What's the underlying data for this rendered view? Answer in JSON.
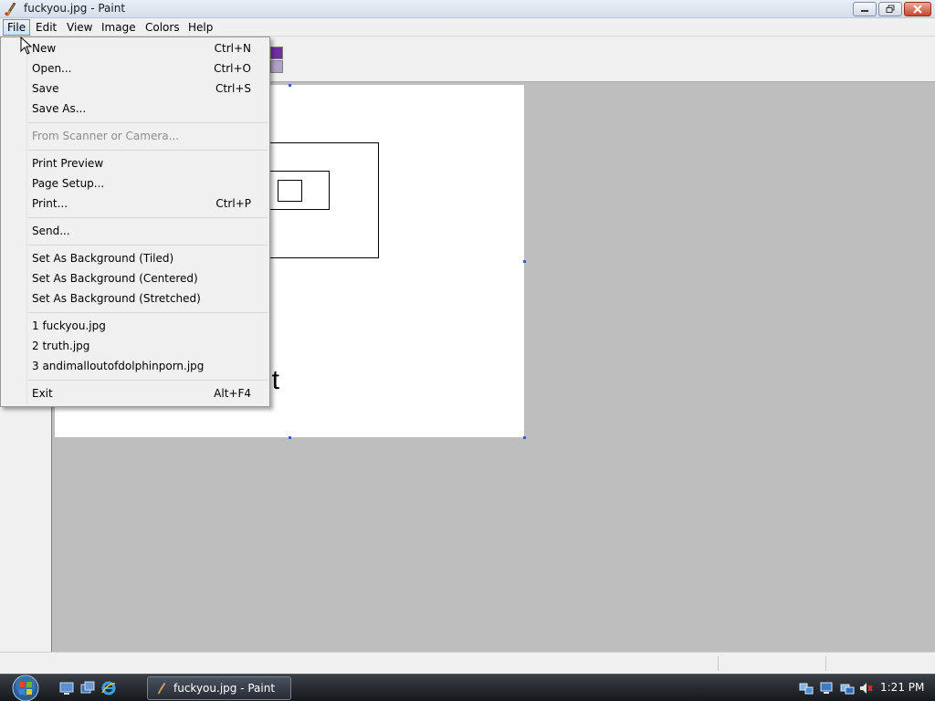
{
  "window": {
    "title": "fuckyou.jpg - Paint",
    "app_icon": "paint-brush-icon"
  },
  "menubar": {
    "items": [
      "File",
      "Edit",
      "View",
      "Image",
      "Colors",
      "Help"
    ],
    "active": "File"
  },
  "file_menu": {
    "new": {
      "label": "New",
      "shortcut": "Ctrl+N"
    },
    "open": {
      "label": "Open...",
      "shortcut": "Ctrl+O"
    },
    "save": {
      "label": "Save",
      "shortcut": "Ctrl+S"
    },
    "save_as": {
      "label": "Save As..."
    },
    "from_scanner": {
      "label": "From Scanner or Camera...",
      "enabled": false
    },
    "print_preview": {
      "label": "Print Preview"
    },
    "page_setup": {
      "label": "Page Setup..."
    },
    "print": {
      "label": "Print...",
      "shortcut": "Ctrl+P"
    },
    "send": {
      "label": "Send..."
    },
    "bg_tiled": {
      "label": "Set As Background (Tiled)"
    },
    "bg_centered": {
      "label": "Set As Background (Centered)"
    },
    "bg_stretched": {
      "label": "Set As Background (Stretched)"
    },
    "recent": [
      "1 fuckyou.jpg",
      "2 truth.jpg",
      "3 andimalloutofdolphinporn.jpg"
    ],
    "exit": {
      "label": "Exit",
      "shortcut": "Alt+F4"
    }
  },
  "canvas": {
    "visible_text": "it"
  },
  "palette": {
    "colors": [
      "#7030a0",
      "#b3a2c7"
    ]
  },
  "taskbar": {
    "start_icon": "windows-orb-icon",
    "quick_launch": [
      "show-desktop-icon",
      "switch-windows-icon",
      "internet-explorer-icon"
    ],
    "task_button_label": "fuckyou.jpg - Paint",
    "tray_icons": [
      "network-icon",
      "network-monitor-icon",
      "volume-muted-icon"
    ],
    "clock": "1:21 PM"
  },
  "colors": {
    "titlebar": "#d4deec",
    "menu_bg": "#f0f0f0",
    "workspace": "#bebebe",
    "taskbar": "#15181c",
    "selection_handle": "#2f62c8"
  }
}
